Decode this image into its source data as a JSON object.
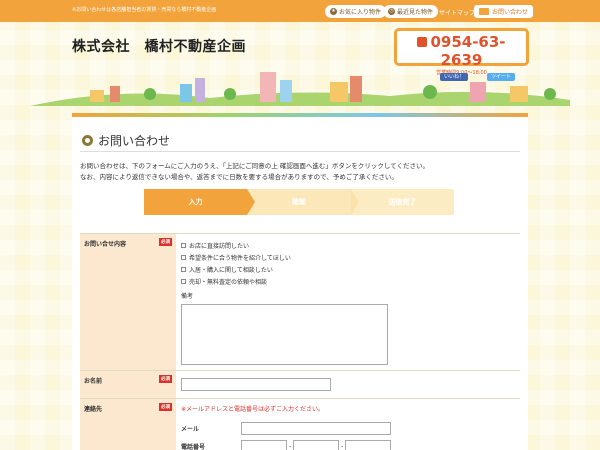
{
  "header": {
    "tagline": "※お問い合わせは各店舗担当者の賃貸・売買なら橋村不動産企画",
    "favorites_label": "お気に入り物件",
    "recent_label": "最近見た物件",
    "sitemap_label": "サイトマップ",
    "contact_label": "お問い合わせ",
    "company_name": "株式会社　橋村不動産企画",
    "phone": "0954-63-2639",
    "hours": "営業時間9:00～18:00",
    "like_label": "いいね！",
    "tweet_label": "ツイート"
  },
  "page": {
    "title": "お問い合わせ",
    "intro_line1": "お問い合わせは、下のフォームにご入力のうえ、「上記にご同意の上 確認画面へ進む」ボタンをクリックしてください。",
    "intro_line2": "なお、内容により返信できない場合や、返答までに日数を要する場合がありますので、予めご了承ください。"
  },
  "steps": [
    {
      "label": "入力"
    },
    {
      "label": "確認"
    },
    {
      "label": "送信完了"
    }
  ],
  "form": {
    "required_label": "必須",
    "inquiry": {
      "label": "お問い合せ内容",
      "options": [
        "お店に直接訪問したい",
        "希望条件に合う物件を紹介してほしい",
        "入居・購入に関して相談したい",
        "売却・無料査定の依頼や相談"
      ],
      "remarks_label": "備考"
    },
    "name": {
      "label": "お名前"
    },
    "contact": {
      "label": "連絡先",
      "note": "※メールアドレスと電話番号は必ずご入力ください。",
      "email_label": "メール",
      "phone_label": "電話番号",
      "separator": "-"
    }
  },
  "colors": {
    "accent": "#f2a33b",
    "required": "#d9322c",
    "phone": "#e0522b"
  }
}
